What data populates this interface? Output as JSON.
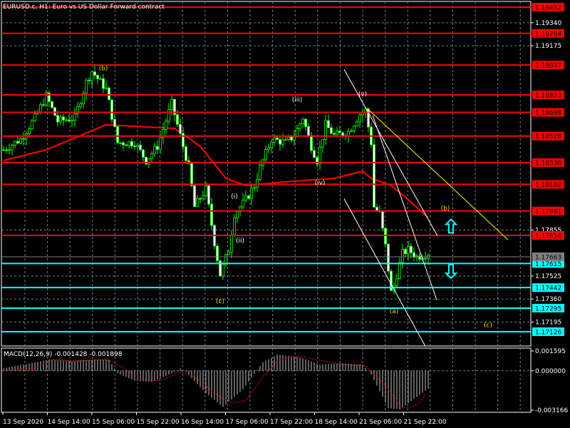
{
  "window": {
    "title": "EURUSD.c, H1:  Euro vs US Dollar Forward contract"
  },
  "price_scale": {
    "max": 1.19452,
    "min": 1.17126,
    "labels": [
      "1.19340",
      "1.19175",
      "1.17855",
      "1.17525",
      "1.17360",
      "1.17195"
    ]
  },
  "levels": {
    "resistance_color": "#ff0000",
    "support_color": "#00ffff",
    "current_color": "#808080",
    "resistance": [
      "1.19452",
      "1.19264",
      "1.19037",
      "1.18823",
      "1.18698",
      "1.18528",
      "1.18338",
      "1.18182",
      "1.17991",
      "1.17816"
    ],
    "support": [
      "1.17615",
      "1.17442",
      "1.17295",
      "1.17126"
    ],
    "current": "1.17663"
  },
  "price_keypoints": [
    [
      0,
      1.1843
    ],
    [
      6,
      1.18506
    ],
    [
      11,
      1.1866
    ],
    [
      15,
      1.18813
    ],
    [
      19,
      1.18634
    ],
    [
      25,
      1.1866
    ],
    [
      29,
      1.18915
    ],
    [
      31,
      1.18992
    ],
    [
      36,
      1.18864
    ],
    [
      40,
      1.18481
    ],
    [
      46,
      1.18481
    ],
    [
      50,
      1.18353
    ],
    [
      54,
      1.18455
    ],
    [
      59,
      1.18762
    ],
    [
      62,
      1.18532
    ],
    [
      65,
      1.18302
    ],
    [
      67,
      1.18021
    ],
    [
      71,
      1.18148
    ],
    [
      74,
      1.17765
    ],
    [
      76,
      1.17535
    ],
    [
      79,
      1.17714
    ],
    [
      81,
      1.1797
    ],
    [
      85,
      1.18072
    ],
    [
      88,
      1.18174
    ],
    [
      90,
      1.18302
    ],
    [
      94,
      1.18506
    ],
    [
      99,
      1.18481
    ],
    [
      102,
      1.18532
    ],
    [
      105,
      1.1866
    ],
    [
      108,
      1.18455
    ],
    [
      110,
      1.18353
    ],
    [
      113,
      1.18609
    ],
    [
      116,
      1.18532
    ],
    [
      121,
      1.18557
    ],
    [
      125,
      1.18685
    ],
    [
      127,
      1.18711
    ],
    [
      129,
      1.18481
    ],
    [
      130,
      1.18021
    ],
    [
      132,
      1.1797
    ],
    [
      134,
      1.17739
    ],
    [
      136,
      1.17407
    ],
    [
      137,
      1.17458
    ],
    [
      140,
      1.17688
    ],
    [
      142,
      1.17714
    ],
    [
      145,
      1.17663
    ],
    [
      149,
      1.17688
    ]
  ],
  "ma_keypoints": [
    [
      0,
      1.18353
    ],
    [
      15,
      1.1843
    ],
    [
      30,
      1.18558
    ],
    [
      36,
      1.18609
    ],
    [
      60,
      1.18583
    ],
    [
      69,
      1.18455
    ],
    [
      78,
      1.18225
    ],
    [
      85,
      1.18174
    ],
    [
      99,
      1.182
    ],
    [
      116,
      1.18225
    ],
    [
      126,
      1.18276
    ],
    [
      129,
      1.18225
    ],
    [
      136,
      1.18174
    ],
    [
      142,
      1.18072
    ],
    [
      149,
      1.17944
    ]
  ],
  "wave_labels": [
    {
      "text": "(b)",
      "color": "#ffd700",
      "bar": 35,
      "price": 1.19
    },
    {
      "text": "(i)",
      "color": "#ffffff",
      "bar": 81,
      "price": 1.18082
    },
    {
      "text": "(ii)",
      "color": "#ffffff",
      "bar": 83,
      "price": 1.17765
    },
    {
      "text": "(c)",
      "color": "#ffd700",
      "bar": 76,
      "price": 1.1733
    },
    {
      "text": "(iii)",
      "color": "#ffffff",
      "bar": 103,
      "price": 1.18775
    },
    {
      "text": "(iv)",
      "color": "#ffffff",
      "bar": 111,
      "price": 1.1818
    },
    {
      "text": "(v)",
      "color": "#ffffff",
      "bar": 126,
      "price": 1.18815
    },
    {
      "text": "(a)",
      "color": "#ffd700",
      "bar": 137,
      "price": 1.1726
    },
    {
      "text": "(b)",
      "color": "#ffd700",
      "bar": 155,
      "price": 1.17995
    },
    {
      "text": "(c)",
      "color": "#ffd700",
      "bar": 170,
      "price": 1.1716
    }
  ],
  "trend_lines": [
    {
      "color": "#ffffff",
      "from": [
        119.5,
        1.19004
      ],
      "to": [
        152.25,
        1.17813
      ]
    },
    {
      "color": "#ffffff",
      "from": [
        129.5,
        1.18677
      ],
      "to": [
        152,
        1.17353
      ]
    },
    {
      "color": "#ffffff",
      "from": [
        119.5,
        1.18079
      ],
      "to": [
        148,
        1.17021
      ]
    },
    {
      "color": "#ffff00",
      "from": [
        127.5,
        1.18728
      ],
      "to": [
        177,
        1.17784
      ]
    }
  ],
  "arrows": [
    {
      "name": "up-arrow-icon",
      "dir": "up",
      "bar": 157,
      "price": 1.1788,
      "color": "#00ffff"
    },
    {
      "name": "down-arrow-icon",
      "dir": "down",
      "bar": 157,
      "price": 1.1756,
      "color": "#00ffff"
    }
  ],
  "macd": {
    "label": "MACD(12,26,9) -0.001428 -0.001898",
    "scale_labels": [
      "0.001595",
      "0.000000",
      "-0.003166"
    ],
    "max": 0.001595,
    "min": -0.003166,
    "histogram_keypoints": [
      [
        0,
        0.0002
      ],
      [
        9,
        0.0006
      ],
      [
        16,
        0.0009
      ],
      [
        24,
        0.0008
      ],
      [
        31,
        0.0009
      ],
      [
        37,
        0.0009
      ],
      [
        40,
        -0.0002
      ],
      [
        46,
        -0.0008
      ],
      [
        52,
        -0.0009
      ],
      [
        60,
        -0.0001
      ],
      [
        62,
        0.0002
      ],
      [
        64,
        -0.0001
      ],
      [
        71,
        -0.0018
      ],
      [
        77,
        -0.0029
      ],
      [
        84,
        -0.0015
      ],
      [
        91,
        0.0007
      ],
      [
        96,
        0.0013
      ],
      [
        104,
        0.0011
      ],
      [
        111,
        0.0005
      ],
      [
        119,
        0.0006
      ],
      [
        126,
        0.0005
      ],
      [
        129,
        -0.0003
      ],
      [
        135,
        -0.003
      ],
      [
        139,
        -0.0031
      ],
      [
        149,
        -0.001428
      ]
    ],
    "signal_keypoints": [
      [
        0,
        0.0001
      ],
      [
        11,
        0.0002
      ],
      [
        17,
        0.0009
      ],
      [
        26,
        0.0008
      ],
      [
        36,
        0.0009
      ],
      [
        40,
        0.0005
      ],
      [
        49,
        -0.0007
      ],
      [
        55,
        -0.0008
      ],
      [
        62,
        -0.0001
      ],
      [
        67,
        -0.0005
      ],
      [
        74,
        -0.0018
      ],
      [
        80,
        -0.0026
      ],
      [
        85,
        -0.0024
      ],
      [
        91,
        -0.0005
      ],
      [
        96,
        0.0008
      ],
      [
        104,
        0.0012
      ],
      [
        109,
        0.0009
      ],
      [
        119,
        0.0005
      ],
      [
        127,
        0.0004
      ],
      [
        134,
        -0.0012
      ],
      [
        140,
        -0.003
      ],
      [
        145,
        -0.0028
      ],
      [
        148,
        -0.001898
      ]
    ],
    "histogram_color": "#c0c0c0",
    "signal_color": "#ff0000"
  },
  "time_axis": [
    "13 Sep 2020",
    "14 Sep 14:00",
    "15 Sep 06:00",
    "15 Sep 22:00",
    "16 Sep 14:00",
    "17 Sep 06:00",
    "17 Sep 22:00",
    "18 Sep 14:00",
    "21 Sep 06:00",
    "21 Sep 22:00"
  ],
  "colors": {
    "candle": "#00ff00",
    "ma": "#ff0000",
    "grid": "#6e7f91",
    "axis": "#ffffff"
  }
}
